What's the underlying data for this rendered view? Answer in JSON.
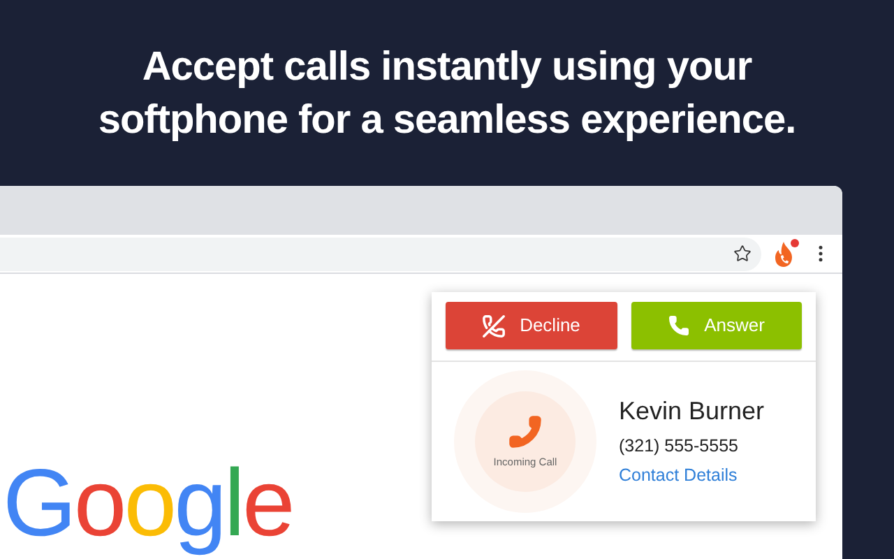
{
  "headline": {
    "lines": [
      "Accept calls instantly using your",
      "softphone for a seamless experience."
    ]
  },
  "toolbar": {
    "extension_badge": true
  },
  "page": {
    "logo": "Google"
  },
  "call_popup": {
    "buttons": [
      {
        "kind": "decline",
        "label": "Decline"
      },
      {
        "kind": "answer",
        "label": "Answer"
      }
    ],
    "status": "Incoming Call",
    "caller_name": "Kevin Burner",
    "caller_number": "(321) 555-5555",
    "link": "Contact Details"
  }
}
